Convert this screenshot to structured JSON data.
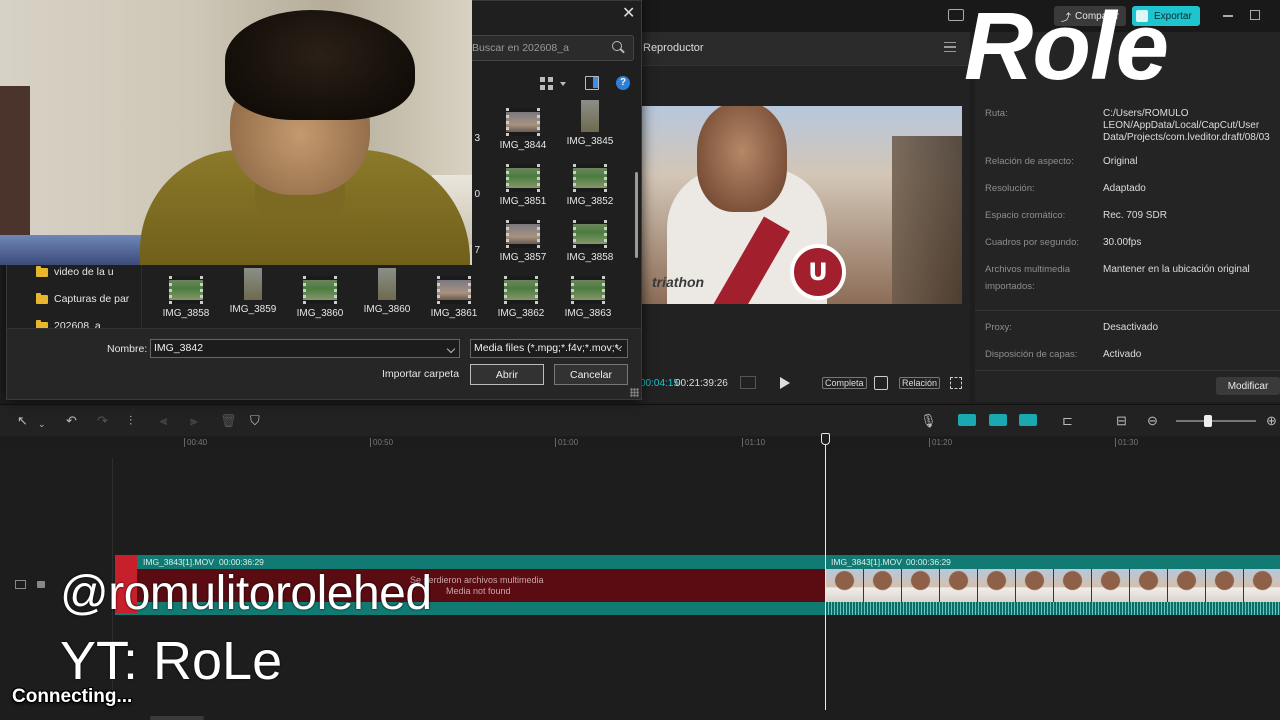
{
  "app": {
    "share_label": "Compartir",
    "export_label": "Exportar",
    "overlay_title": "Role"
  },
  "player": {
    "title": "Reproductor",
    "current_time": "00:04:15",
    "total_time": "00:21:39:26",
    "completa_label": "Completa",
    "relacion_label": "Relación",
    "video_brand": "triathon"
  },
  "details": {
    "rows": [
      {
        "label": "Ruta:",
        "value": "C:/Users/ROMULO LEON/AppData/Local/CapCut/User Data/Projects/com.lveditor.draft/08/03"
      },
      {
        "label": "Relación de aspecto:",
        "value": "Original"
      },
      {
        "label": "Resolución:",
        "value": "Adaptado"
      },
      {
        "label": "Espacio cromático:",
        "value": "Rec. 709 SDR"
      },
      {
        "label": "Cuadros por segundo:",
        "value": "30.00fps"
      },
      {
        "label": "Archivos multimedia importados:",
        "value": "Mantener en la ubicación original"
      },
      {
        "label": "Proxy:",
        "value": "Desactivado"
      },
      {
        "label": "Disposición de capas:",
        "value": "Activado"
      }
    ],
    "modify_label": "Modificar"
  },
  "timeline": {
    "ruler_ticks": [
      "00:40",
      "00:50",
      "01:00",
      "01:10",
      "01:20",
      "01:30"
    ],
    "clips": [
      {
        "name": "IMG_3843[1].MOV",
        "duration": "00:00:36:29",
        "missing_message": "Se perdieron archivos multimedia",
        "missing_sub": "Media not found"
      },
      {
        "name": "IMG_3843[1].MOV",
        "duration": "00:00:36:29"
      }
    ]
  },
  "overlay": {
    "handle": "@romulitorolehed",
    "youtube": "YT: RoLe",
    "status": "Connecting..."
  },
  "dialog": {
    "search_placeholder": "Buscar en 202608_a",
    "nav_items": [
      "video de la u",
      "Capturas de par",
      "202608_a"
    ],
    "grid_rows": [
      [
        {
          "name": "IMG_3844",
          "style": "people"
        },
        {
          "name": "IMG_3845",
          "style": "portrait"
        }
      ],
      [
        {
          "name": "IMG_3851",
          "style": "field"
        },
        {
          "name": "IMG_3852",
          "style": "field"
        }
      ],
      [
        {
          "name": "IMG_3857",
          "style": "people"
        },
        {
          "name": "IMG_3858",
          "style": "field"
        }
      ],
      [
        {
          "name": "IMG_3858",
          "style": "field"
        },
        {
          "name": "IMG_3859",
          "style": "portrait"
        },
        {
          "name": "IMG_3860",
          "style": "field"
        },
        {
          "name": "IMG_3860",
          "style": "portrait"
        },
        {
          "name": "IMG_3861",
          "style": "people"
        },
        {
          "name": "IMG_3862",
          "style": "field"
        },
        {
          "name": "IMG_3863",
          "style": "field"
        }
      ]
    ],
    "partial_suffixes": [
      "3",
      "0",
      "7"
    ],
    "name_label": "Nombre:",
    "name_value": "IMG_3842",
    "filetype_value": "Media files (*.mpg;*.f4v;*.mov;*.",
    "import_folder_label": "Importar carpeta",
    "open_label": "Abrir",
    "cancel_label": "Cancelar"
  }
}
